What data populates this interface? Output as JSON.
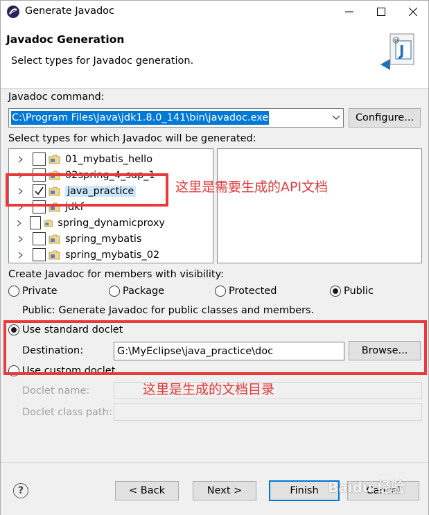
{
  "window": {
    "title": "Generate Javadoc"
  },
  "header": {
    "title": "Javadoc Generation",
    "description": "Select types for Javadoc generation."
  },
  "javadoc_command": {
    "label": "Javadoc command:",
    "value": "C:\\Program Files\\Java\\jdk1.8.0_141\\bin\\javadoc.exe",
    "configure_label": "Configure..."
  },
  "types": {
    "label": "Select types for which Javadoc will be generated:",
    "items": [
      {
        "label": "01_mybatis_hello",
        "checked": false
      },
      {
        "label": "02spring_4_sup_1",
        "checked": false
      },
      {
        "label": "java_practice",
        "checked": true
      },
      {
        "label": "jdkf",
        "checked": false
      },
      {
        "label": "spring_dynamicproxy",
        "checked": false
      },
      {
        "label": "spring_mybatis",
        "checked": false
      },
      {
        "label": "spring_mybatis_02",
        "checked": false
      }
    ]
  },
  "visibility": {
    "label": "Create Javadoc for members with visibility:",
    "options": [
      "Private",
      "Package",
      "Protected",
      "Public"
    ],
    "selected": "Public",
    "description": "Public: Generate Javadoc for public classes and members."
  },
  "doclet": {
    "standard_label": "Use standard doclet",
    "destination_label": "Destination:",
    "destination_value": "G:\\MyEclipse\\java_practice\\doc",
    "browse_label": "Browse...",
    "custom_label": "Use custom doclet",
    "doclet_name_label": "Doclet name:",
    "doclet_classpath_label": "Doclet class path:"
  },
  "annotations": {
    "api_note": "这里是需要生成的API文档",
    "dir_note": "这里是生成的文档目录"
  },
  "footer": {
    "help_icon": "?",
    "back_label": "< Back",
    "next_label": "Next >",
    "finish_label": "Finish",
    "cancel_label": "Cancel"
  },
  "watermark": "Baidu 经验",
  "colors": {
    "selection": "#0078d7",
    "annotation": "#e83a3a",
    "finish_border": "#0078d7"
  }
}
